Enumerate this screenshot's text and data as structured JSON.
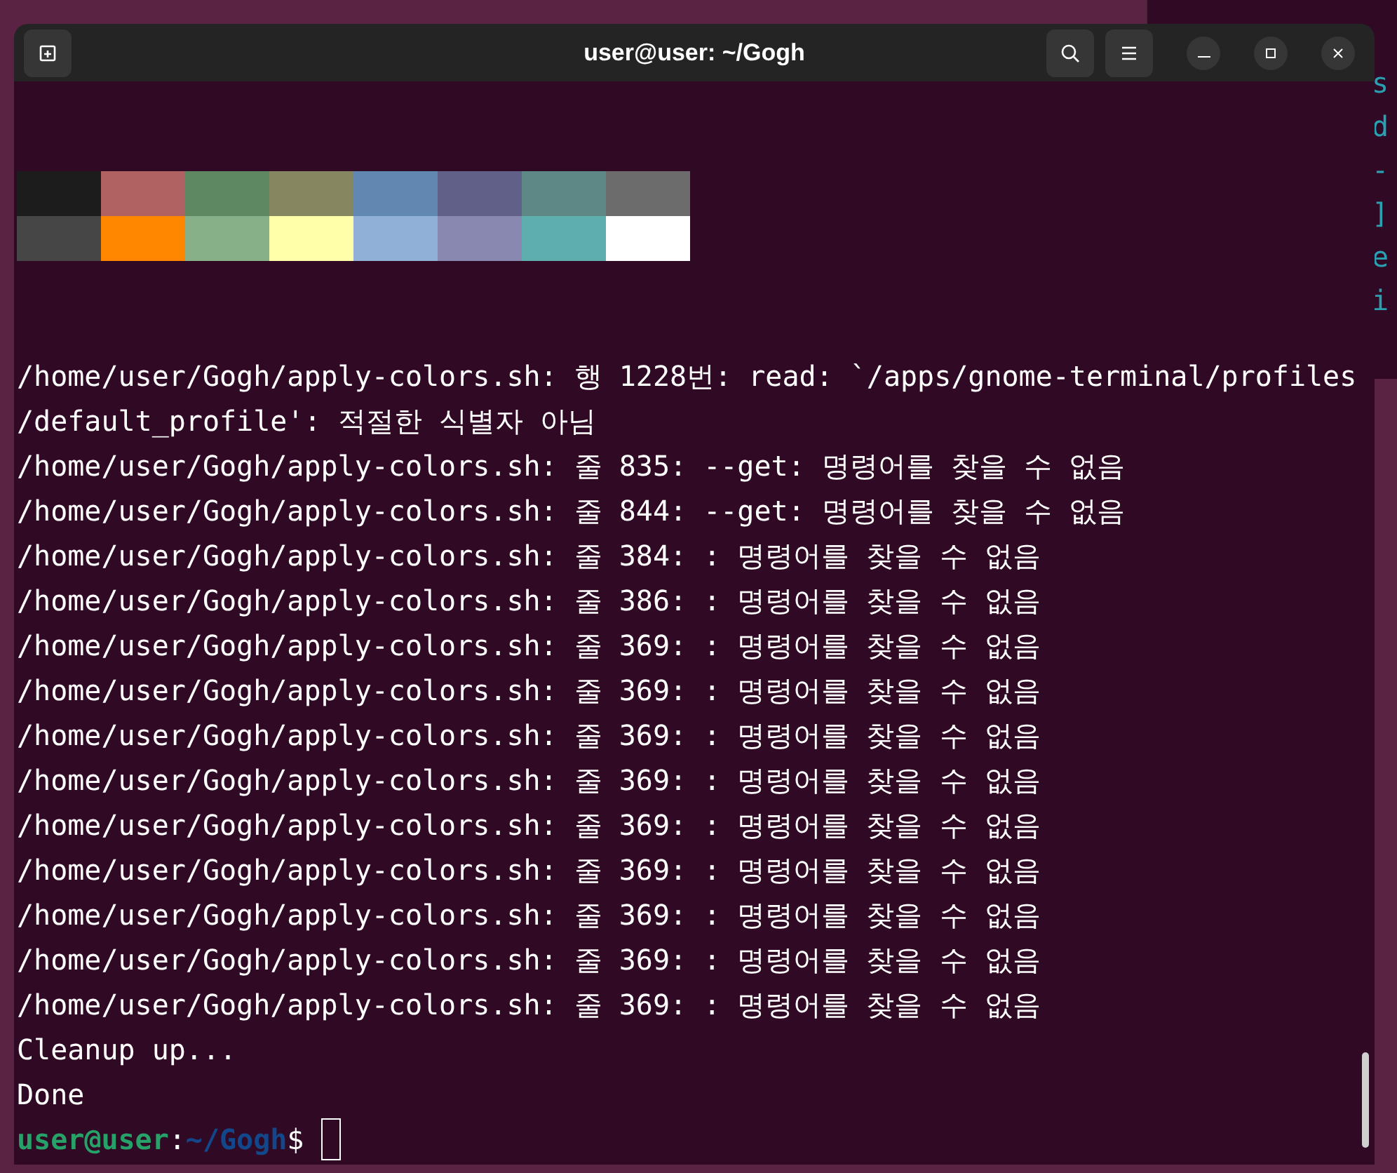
{
  "window": {
    "title": "user@user: ~/Gogh"
  },
  "background_window": {
    "lines": [
      "s",
      "d",
      "-",
      "]",
      "e",
      "i"
    ]
  },
  "palette": [
    {
      "color": "#1c1c1c"
    },
    {
      "color": "#b06262"
    },
    {
      "color": "#5e8862"
    },
    {
      "color": "#868660"
    },
    {
      "color": "#6088b0"
    },
    {
      "color": "#606088"
    },
    {
      "color": "#5e8886"
    },
    {
      "color": "#6c6c6c"
    },
    {
      "color": "#464646"
    },
    {
      "color": "#ff8700"
    },
    {
      "color": "#88b088"
    },
    {
      "color": "#ffffaa"
    },
    {
      "color": "#90b0d8"
    },
    {
      "color": "#8888b0"
    },
    {
      "color": "#5eaeae"
    },
    {
      "color": "#ffffff"
    }
  ],
  "output": [
    "/home/user/Gogh/apply-colors.sh: 행 1228번: read: `/apps/gnome-terminal/profiles",
    "/default_profile': 적절한 식별자 아님",
    "/home/user/Gogh/apply-colors.sh: 줄 835: --get: 명령어를 찾을 수 없음",
    "/home/user/Gogh/apply-colors.sh: 줄 844: --get: 명령어를 찾을 수 없음",
    "/home/user/Gogh/apply-colors.sh: 줄 384: : 명령어를 찾을 수 없음",
    "/home/user/Gogh/apply-colors.sh: 줄 386: : 명령어를 찾을 수 없음",
    "/home/user/Gogh/apply-colors.sh: 줄 369: : 명령어를 찾을 수 없음",
    "/home/user/Gogh/apply-colors.sh: 줄 369: : 명령어를 찾을 수 없음",
    "/home/user/Gogh/apply-colors.sh: 줄 369: : 명령어를 찾을 수 없음",
    "/home/user/Gogh/apply-colors.sh: 줄 369: : 명령어를 찾을 수 없음",
    "/home/user/Gogh/apply-colors.sh: 줄 369: : 명령어를 찾을 수 없음",
    "/home/user/Gogh/apply-colors.sh: 줄 369: : 명령어를 찾을 수 없음",
    "/home/user/Gogh/apply-colors.sh: 줄 369: : 명령어를 찾을 수 없음",
    "/home/user/Gogh/apply-colors.sh: 줄 369: : 명령어를 찾을 수 없음",
    "/home/user/Gogh/apply-colors.sh: 줄 369: : 명령어를 찾을 수 없음",
    "Cleanup up...",
    "Done"
  ],
  "prompt": {
    "user_host": "user@user",
    "separator": ":",
    "path": "~/Gogh",
    "symbol": "$"
  }
}
